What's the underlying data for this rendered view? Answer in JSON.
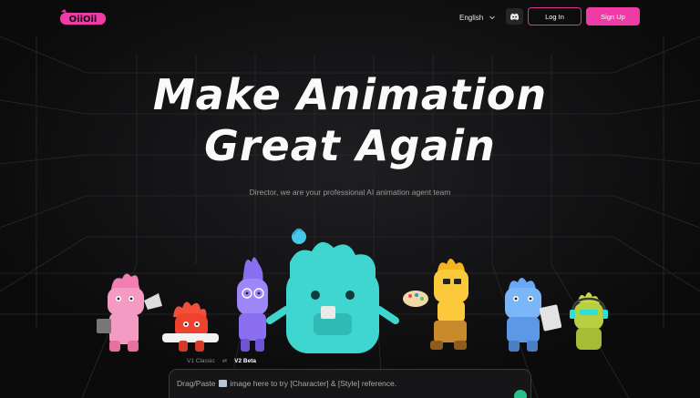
{
  "header": {
    "logo_text": "OiiOii",
    "language_label": "English",
    "login_label": "Log In",
    "signup_label": "Sign Up"
  },
  "hero": {
    "title_line1": "Make Animation",
    "title_line2": "Great Again",
    "subtitle": "Director, we are your professional AI animation agent team"
  },
  "version_toggle": {
    "v1_label": "V1 Classic",
    "swap_symbol": "⇄",
    "v2_label": "V2 Beta"
  },
  "prompt": {
    "placeholder_before": "Drag/Paste",
    "placeholder_after": "image here to try [Character] & [Style] reference."
  },
  "colors": {
    "accent": "#ef3ba6",
    "background": "#0b0b0c",
    "send_button": "#27c08a"
  },
  "icons": [
    "chevron-down-icon",
    "discord-icon",
    "image-icon"
  ]
}
